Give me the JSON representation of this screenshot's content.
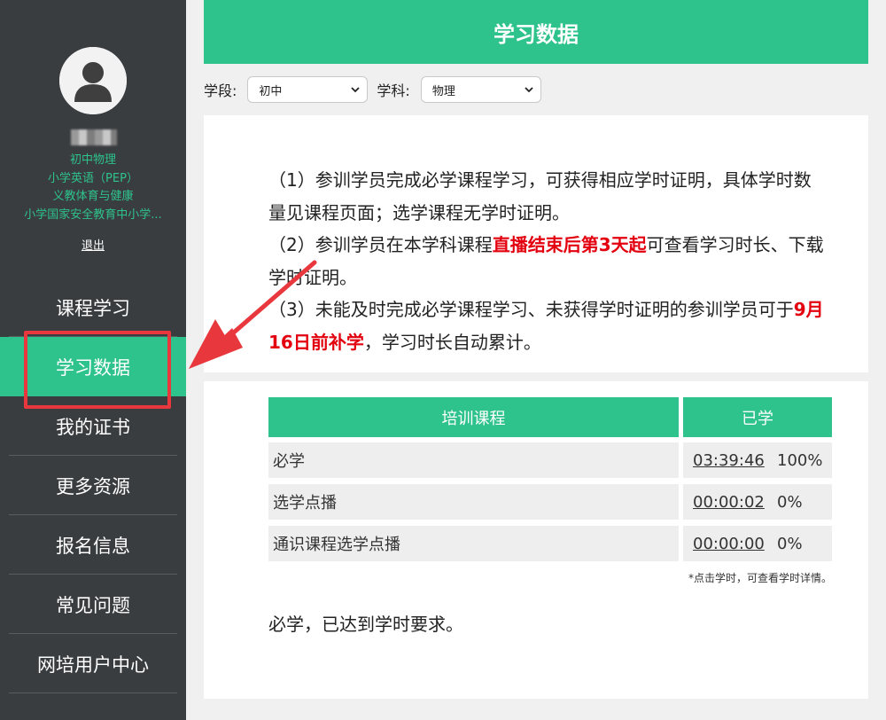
{
  "sidebar": {
    "subjects": [
      "初中物理",
      "小学英语（PEP）",
      "义教体育与健康",
      "小学国家安全教育中小学..."
    ],
    "logout": "退出",
    "nav": [
      {
        "label": "课程学习",
        "active": false
      },
      {
        "label": "学习数据",
        "active": true
      },
      {
        "label": "我的证书",
        "active": false
      },
      {
        "label": "更多资源",
        "active": false
      },
      {
        "label": "报名信息",
        "active": false
      },
      {
        "label": "常见问题",
        "active": false
      },
      {
        "label": "网培用户中心",
        "active": false
      }
    ]
  },
  "header": {
    "title": "学习数据"
  },
  "filters": {
    "stage_label": "学段:",
    "stage_value": "初中",
    "subject_label": "学科:",
    "subject_value": "物理"
  },
  "notice": {
    "p1": "（1）参训学员完成必学课程学习，可获得相应学时证明，具体学时数量见课程页面；选学课程无学时证明。",
    "p2_a": "（2）参训学员在本学科课程",
    "p2_red": "直播结束后第3天起",
    "p2_b": "可查看学习时长、下载学时证明。",
    "p3_a": "（3）未能及时完成必学课程学习、未获得学时证明的参训学员可于",
    "p3_red": "9月16日前补学",
    "p3_b": "，学习时长自动累计。"
  },
  "table": {
    "headers": [
      "培训课程",
      "已学"
    ],
    "rows": [
      {
        "course": "必学",
        "time": "03:39:46",
        "percent": "100%"
      },
      {
        "course": "选学点播",
        "time": "00:00:02",
        "percent": "0%"
      },
      {
        "course": "通识课程选学点播",
        "time": "00:00:00",
        "percent": "0%"
      }
    ],
    "tip": "*点击学时，可查看学时详情。",
    "summary": "必学，已达到学时要求。"
  },
  "colors": {
    "accent": "#2ec28c",
    "sidebar_bg": "#3a3d40",
    "highlight_red": "#e8383d",
    "notice_red": "#e3000f"
  }
}
